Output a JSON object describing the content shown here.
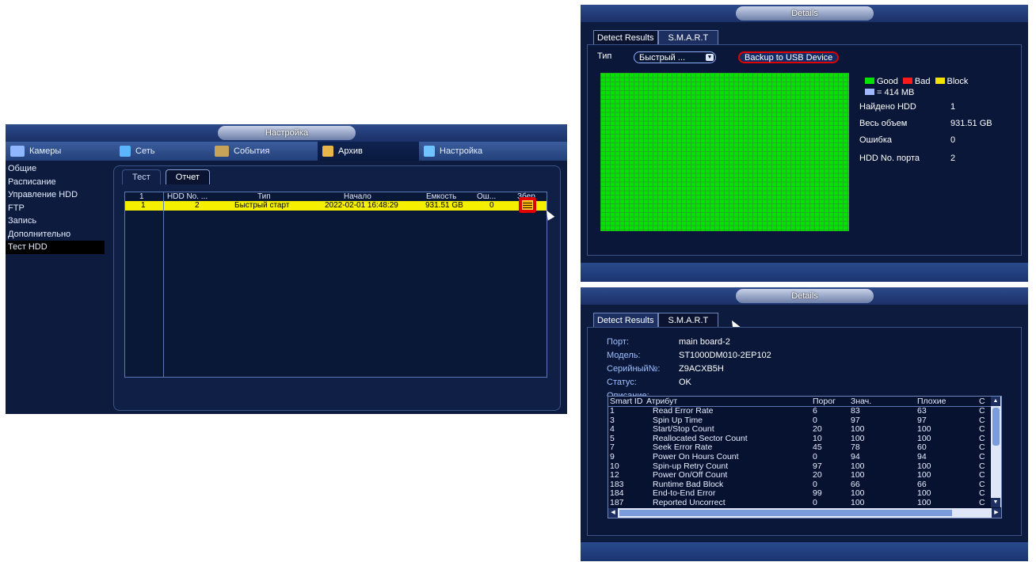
{
  "left_panel": {
    "title": "Настройка",
    "nav": [
      {
        "label": "Камеры",
        "icon": "camera-icon",
        "active": false
      },
      {
        "label": "Сеть",
        "icon": "network-icon",
        "active": false
      },
      {
        "label": "События",
        "icon": "events-icon",
        "active": false
      },
      {
        "label": "Архив",
        "icon": "archive-icon",
        "active": true
      },
      {
        "label": "Настройка",
        "icon": "settings-icon",
        "active": false
      }
    ],
    "sidebar": [
      "Общие",
      "Расписание",
      "Управление HDD",
      "FTP",
      "Запись",
      "Дополнительно",
      "Тест HDD"
    ],
    "sidebar_active": "Тест HDD",
    "tabs": [
      "Тест",
      "Отчет"
    ],
    "table": {
      "headers": [
        "1",
        "HDD No. ...",
        "Тип",
        "Начало",
        "Емкость",
        "Ош...",
        "Збер"
      ],
      "row": [
        "1",
        "2",
        "Быстрый старт",
        "2022-02-01 16:48:29",
        "931.51 GB",
        "0"
      ]
    }
  },
  "details_top": {
    "title": "Details",
    "tabs": [
      "Detect Results",
      "S.M.A.R.T"
    ],
    "type_label": "Тип",
    "type_value": "Быстрый ...",
    "backup_button": "Backup to USB Device",
    "legend": {
      "good": "Good",
      "bad": "Bad",
      "block": "Block",
      "unit": "= 414 MB"
    },
    "colors": {
      "good": "#00e400",
      "bad": "#ff1a1a",
      "block": "#f3e100",
      "unit": "#9fb8ff"
    },
    "info": [
      {
        "label": "Найдено HDD",
        "value": "1"
      },
      {
        "label": "Весь объем",
        "value": "931.51 GB"
      },
      {
        "label": "Ошибка",
        "value": "0"
      },
      {
        "label": "HDD No. порта",
        "value": "2"
      }
    ]
  },
  "details_bottom": {
    "title": "Details",
    "tabs": [
      "Detect Results",
      "S.M.A.R.T"
    ],
    "info": [
      {
        "label": "Порт:",
        "value": "main board-2"
      },
      {
        "label": "Модель:",
        "value": "ST1000DM010-2EP102"
      },
      {
        "label": "Серийный№:",
        "value": "Z9ACXB5H"
      },
      {
        "label": "Статус:",
        "value": "OK"
      }
    ],
    "description_label": "Описание:",
    "smart_headers": [
      "Smart ID",
      "Атрибут",
      "Порог",
      "Знач.",
      "Плохие",
      "С"
    ],
    "smart_rows": [
      [
        "1",
        "Read Error Rate",
        "6",
        "83",
        "63",
        "С"
      ],
      [
        "3",
        "Spin Up Time",
        "0",
        "97",
        "97",
        "С"
      ],
      [
        "4",
        "Start/Stop Count",
        "20",
        "100",
        "100",
        "С"
      ],
      [
        "5",
        "Reallocated Sector Count",
        "10",
        "100",
        "100",
        "С"
      ],
      [
        "7",
        "Seek Error Rate",
        "45",
        "78",
        "60",
        "С"
      ],
      [
        "9",
        "Power On Hours Count",
        "0",
        "94",
        "94",
        "С"
      ],
      [
        "10",
        "Spin-up Retry Count",
        "97",
        "100",
        "100",
        "С"
      ],
      [
        "12",
        "Power On/Off Count",
        "20",
        "100",
        "100",
        "С"
      ],
      [
        "183",
        "Runtime Bad Block",
        "0",
        "66",
        "66",
        "С"
      ],
      [
        "184",
        "End-to-End Error",
        "99",
        "100",
        "100",
        "С"
      ],
      [
        "187",
        "Reported Uncorrect",
        "0",
        "100",
        "100",
        "С"
      ]
    ]
  }
}
